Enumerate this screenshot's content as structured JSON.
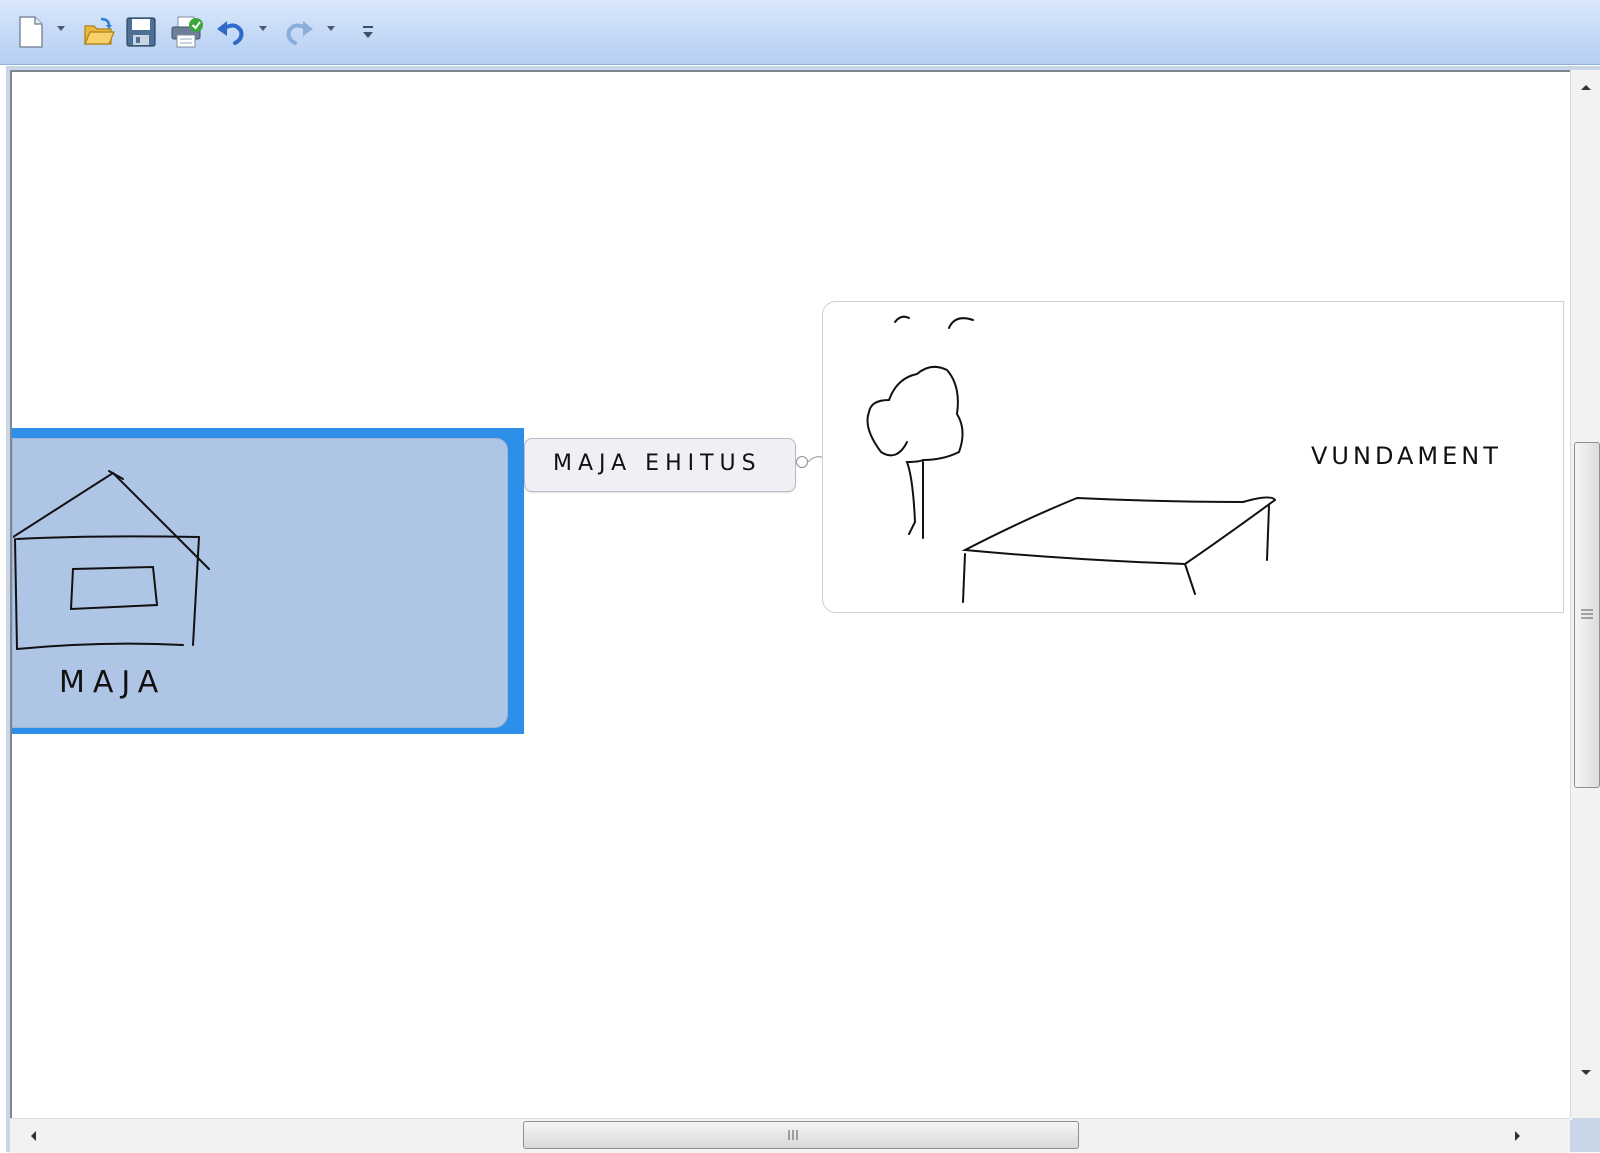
{
  "toolbar": {
    "buttons": [
      {
        "name": "new-document",
        "icon": "new-document-icon",
        "has_dropdown": true
      },
      {
        "name": "open-folder",
        "icon": "open-folder-icon",
        "has_dropdown": false
      },
      {
        "name": "save",
        "icon": "save-icon",
        "has_dropdown": false
      },
      {
        "name": "print",
        "icon": "print-icon",
        "has_dropdown": false
      },
      {
        "name": "undo",
        "icon": "undo-icon",
        "has_dropdown": true
      },
      {
        "name": "redo",
        "icon": "redo-icon",
        "has_dropdown": true,
        "disabled": true
      },
      {
        "name": "customize",
        "icon": "customize-toolbar-icon",
        "has_dropdown": false
      }
    ]
  },
  "mindmap": {
    "central_topic": "MAJA EHITUS",
    "left_topic": {
      "label": "MAJA",
      "selected": true,
      "sketch": "house-sketch"
    },
    "right_topic": {
      "label": "VUNDAMENT",
      "sketch": "tree-and-foundation-sketch"
    }
  },
  "colors": {
    "selection_border": "#2e8fe8",
    "selected_fill": "#afc5e6",
    "toolbar_bg": "#c6daf7"
  }
}
